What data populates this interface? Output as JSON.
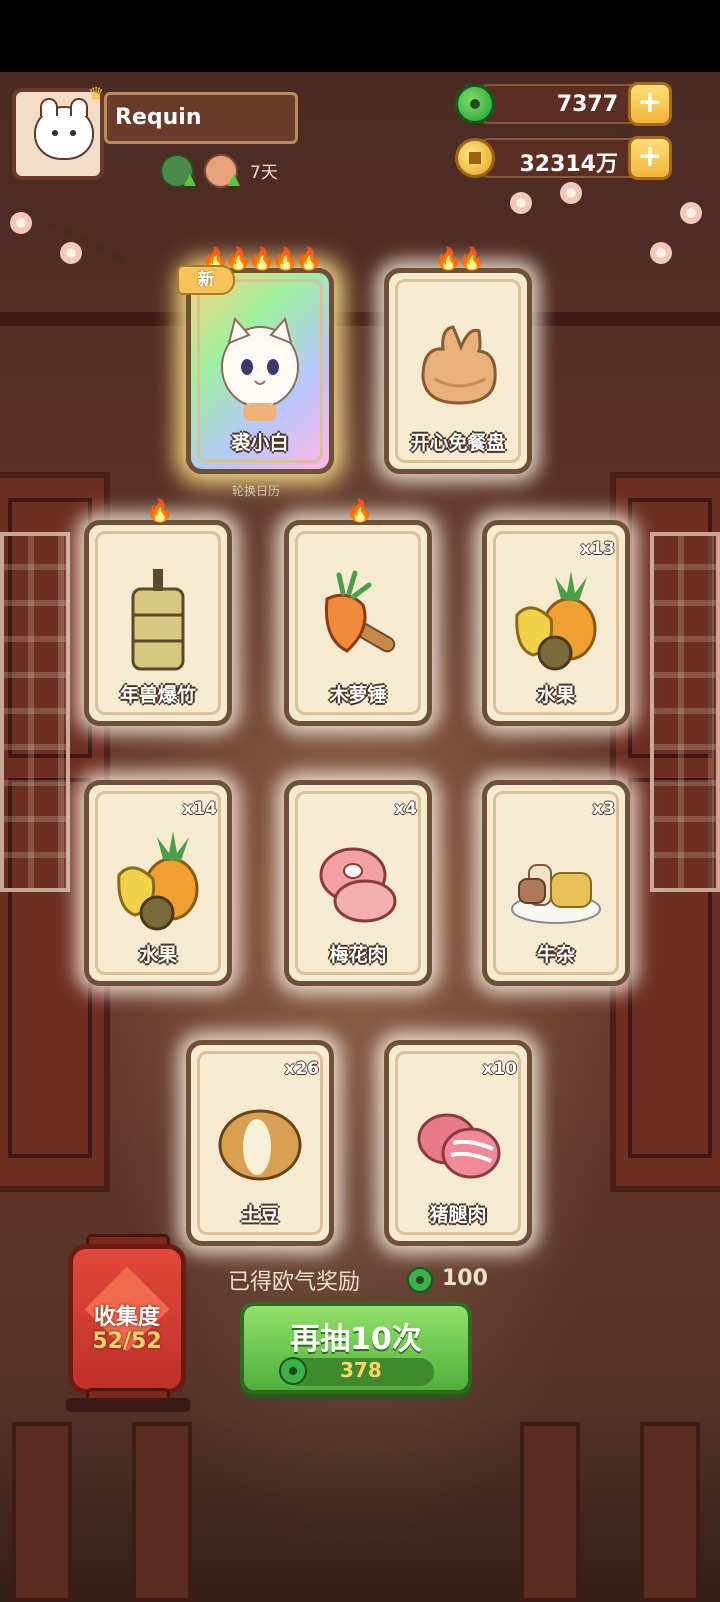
{
  "player": {
    "name": "Requin",
    "days": "7天"
  },
  "resources": {
    "jade": "7377",
    "coins": "32314万"
  },
  "caption": "轮换日历",
  "cards": [
    {
      "label": "裘小白",
      "count": "",
      "flames": "🔥🔥🔥🔥🔥",
      "new_tag": "新"
    },
    {
      "label": "开心免餐盘",
      "count": "",
      "flames": "🔥🔥"
    },
    {
      "label": "年兽爆竹",
      "count": "",
      "flames": "🔥"
    },
    {
      "label": "木萝锤",
      "count": "",
      "flames": "🔥"
    },
    {
      "label": "水果",
      "count": "x13",
      "flames": ""
    },
    {
      "label": "水果",
      "count": "x14",
      "flames": ""
    },
    {
      "label": "梅花肉",
      "count": "x4",
      "flames": ""
    },
    {
      "label": "牛杂",
      "count": "x3",
      "flames": ""
    },
    {
      "label": "土豆",
      "count": "x26",
      "flames": ""
    },
    {
      "label": "猪腿肉",
      "count": "x10",
      "flames": ""
    }
  ],
  "collection": {
    "title": "收集度",
    "value": "52/52"
  },
  "reward": {
    "label": "已得欧气奖励",
    "value": "100"
  },
  "draw_button": {
    "label": "再抽10次",
    "cost": "378"
  }
}
